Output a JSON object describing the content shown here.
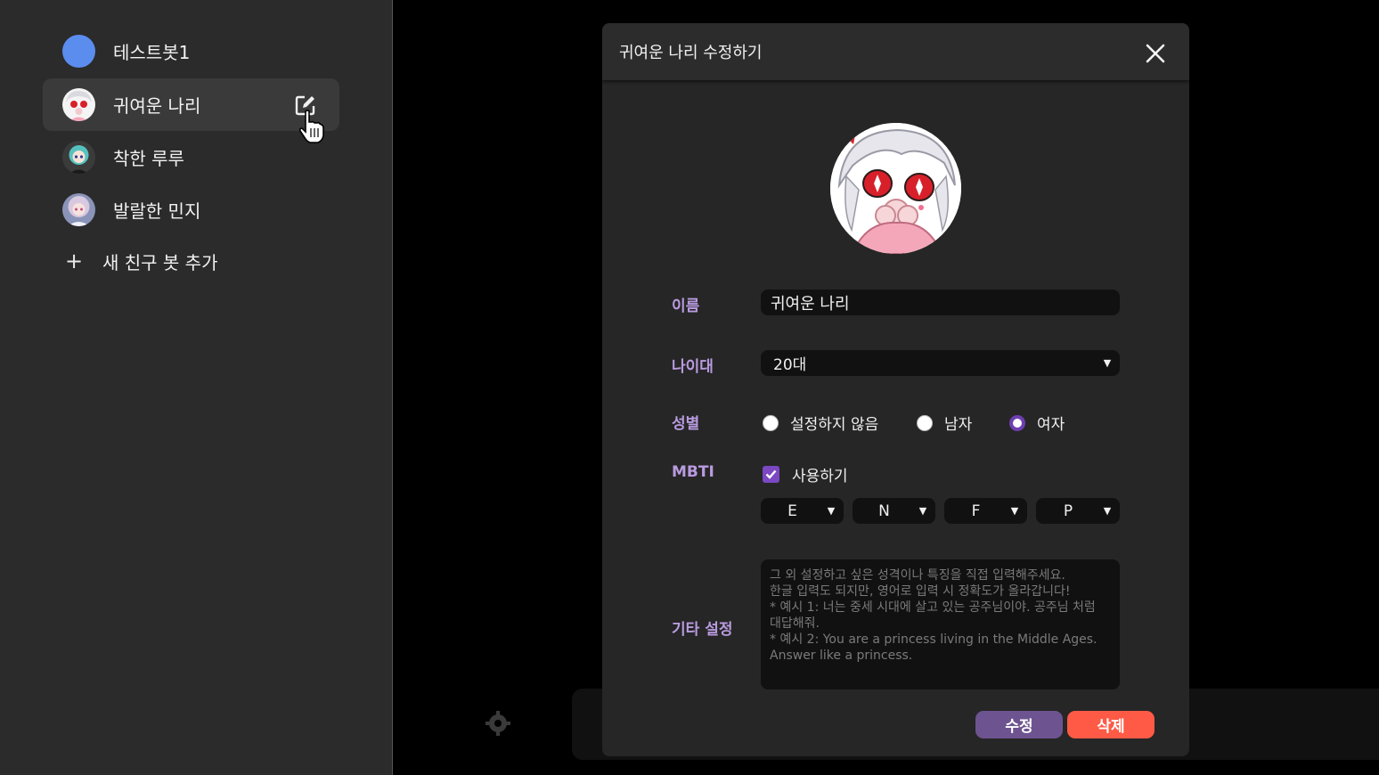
{
  "sidebar": {
    "items": [
      {
        "label": "테스트봇1",
        "avatar": "blue-circle"
      },
      {
        "label": "귀여운 나리",
        "avatar": "nari"
      },
      {
        "label": "착한 루루",
        "avatar": "ruru"
      },
      {
        "label": "발랄한 민지",
        "avatar": "minji"
      }
    ],
    "add_label": "새 친구 봇 추가",
    "add_icon": "+"
  },
  "modal": {
    "title": "귀여운 나리 수정하기",
    "name": {
      "label": "이름",
      "value": "귀여운 나리"
    },
    "age": {
      "label": "나이대",
      "value": "20대"
    },
    "gender": {
      "label": "성별",
      "options": [
        "설정하지 않음",
        "남자",
        "여자"
      ],
      "selected": "여자"
    },
    "mbti": {
      "label": "MBTI",
      "enable_label": "사용하기",
      "enabled": true,
      "values": [
        "E",
        "N",
        "F",
        "P"
      ]
    },
    "extra": {
      "label": "기타 설정",
      "placeholder": "그 외 설정하고 싶은 성격이나 특징을 직접 입력해주세요.\n한글 입력도 되지만, 영어로 입력 시 정확도가 올라갑니다!\n* 예시 1: 너는 중세 시대에 살고 있는 공주님이야. 공주님 처럼 대답해줘.\n* 예시 2: You are a princess living in the Middle Ages. Answer like a princess."
    },
    "buttons": {
      "edit": "수정",
      "delete": "삭제"
    }
  },
  "colors": {
    "accent_purple": "#b99be0",
    "edit_button": "#6d5490",
    "delete_button": "#ff5a45",
    "checkbox": "#7b47c2"
  }
}
